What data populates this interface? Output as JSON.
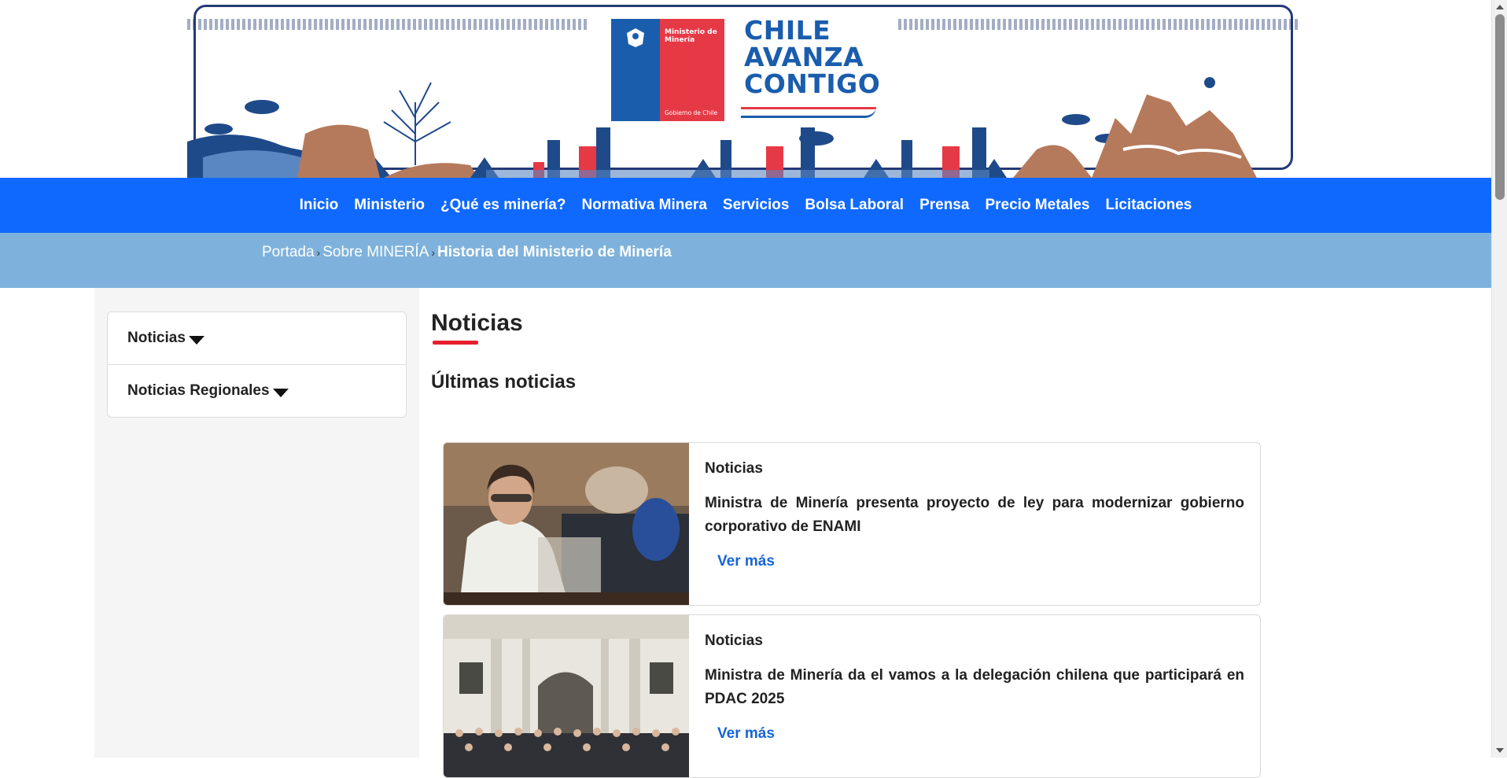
{
  "header": {
    "logo_top": "Ministerio de Minería",
    "logo_bottom": "Gobierno de Chile",
    "slogan": [
      "CHILE",
      "AVANZA",
      "CONTIGO"
    ],
    "colors": {
      "blue": "#1a5dad",
      "red": "#e63946",
      "navy": "#233a75"
    }
  },
  "nav": {
    "items": [
      "Inicio",
      "Ministerio",
      "¿Qué es minería?",
      "Normativa Minera",
      "Servicios",
      "Bolsa Laboral",
      "Prensa",
      "Precio Metales",
      "Licitaciones"
    ],
    "background": "#0f69ff"
  },
  "breadcrumb": {
    "items": [
      "Portada",
      "Sobre MINERÍA"
    ],
    "current": "Historia del Ministerio de Minería",
    "separator": "›"
  },
  "sidebar": {
    "items": [
      {
        "label": "Noticias",
        "icon": "caret-down-icon"
      },
      {
        "label": "Noticias Regionales",
        "icon": "caret-down-icon"
      }
    ]
  },
  "content": {
    "title": "Noticias",
    "section_title": "Últimas noticias",
    "news": [
      {
        "category": "Noticias",
        "headline": "Ministra de Minería presenta proyecto de ley para modernizar gobierno corporativo de ENAMI",
        "link": "Ver más"
      },
      {
        "category": "Noticias",
        "headline": "Ministra de Minería da el vamos a la delegación chilena que participará en PDAC 2025",
        "link": "Ver más"
      }
    ]
  }
}
